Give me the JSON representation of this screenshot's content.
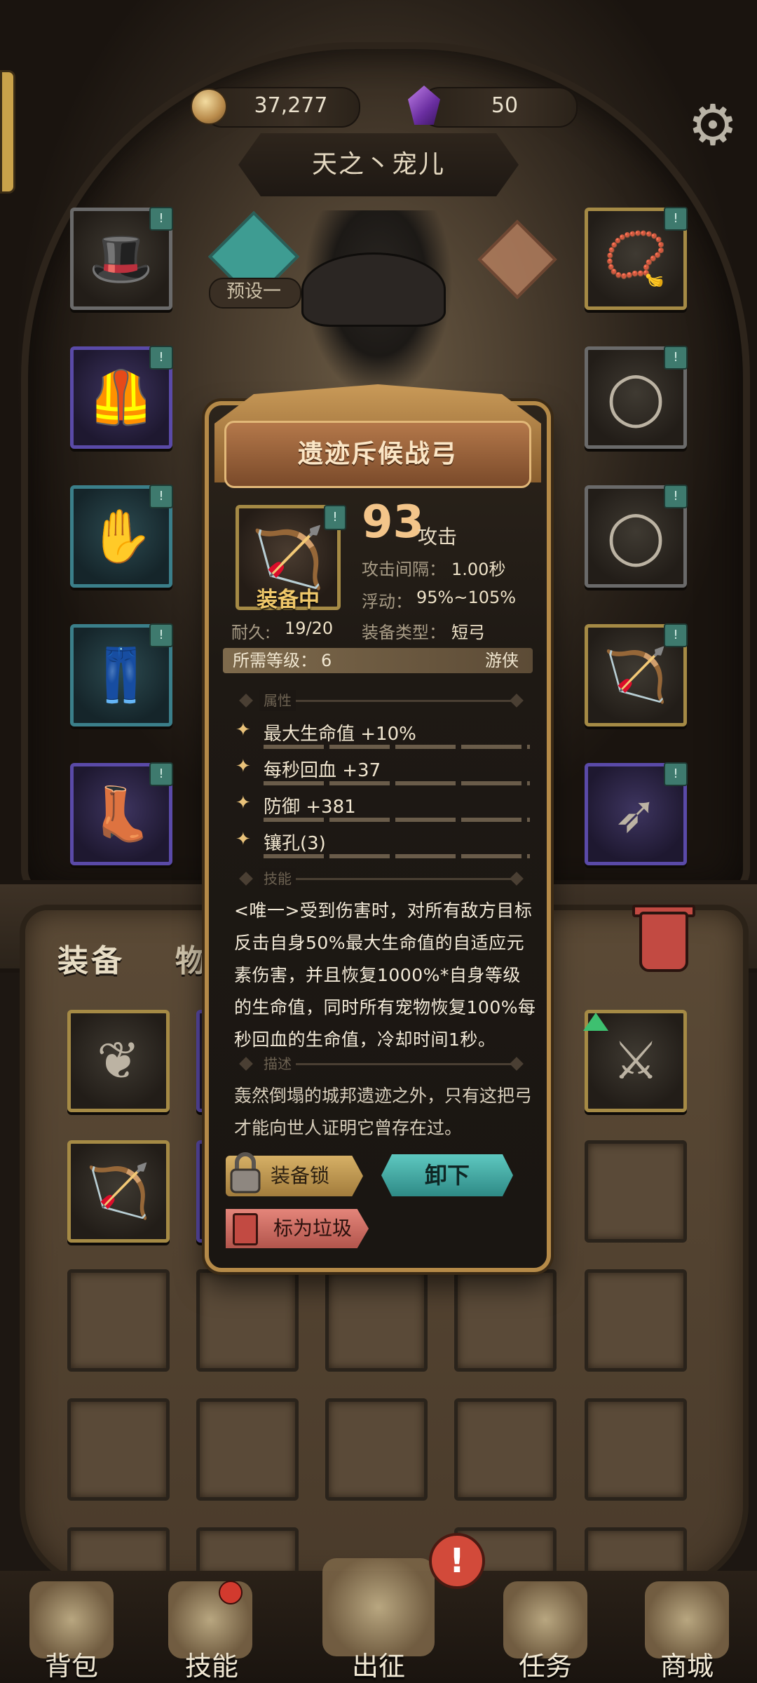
{
  "currency": {
    "coins": "37,277",
    "gems": "50"
  },
  "player": {
    "name": "天之丶宠儿",
    "preset_label": "预设一"
  },
  "bag_tabs": {
    "equipment": "装备",
    "items": "物品"
  },
  "tooltip": {
    "item_name": "遗迹斥候战弓",
    "status": "装备中",
    "attack_value": "93",
    "attack_label": "攻击",
    "stats": [
      {
        "label": "攻击间隔：",
        "value": "1.00秒"
      },
      {
        "label": "浮动：",
        "value": "95%~105%"
      },
      {
        "label": "装备类型：",
        "value": "短弓"
      }
    ],
    "durability_label": "耐久:",
    "durability_value": "19/20",
    "required_level_label": "所需等级：",
    "required_level_value": "6",
    "required_class": "游侠",
    "attributes_header": "属性",
    "attributes": [
      "最大生命值 +10%",
      "每秒回血 +37",
      "防御 +381",
      "镶孔(3)"
    ],
    "skills_header": "技能",
    "skill_text": "<唯一>受到伤害时，对所有敌方目标反击自身50%最大生命值的自适应元素伤害，并且恢复1000%*自身等级的生命值，同时所有宠物恢复100%每秒回血的生命值，冷却时间1秒。",
    "description_header": "描述",
    "description_text": "轰然倒塌的城邦遗迹之外，只有这把弓才能向世人证明它曾存在过。",
    "lock_button": "装备锁",
    "unequip_button": "卸下",
    "junk_button": "标为垃圾"
  },
  "bottom_nav": [
    {
      "label": "背包"
    },
    {
      "label": "技能"
    },
    {
      "label": "出征"
    },
    {
      "label": "任务"
    },
    {
      "label": "商城"
    }
  ],
  "colors": {
    "rarity_gold": "#a58a45",
    "rarity_purple": "#5a4aa8",
    "rarity_teal": "#3b7f8a",
    "attack_accent": "#f3c58a",
    "unequip_button": "#5ec8c0",
    "junk_button": "#e4857a"
  }
}
